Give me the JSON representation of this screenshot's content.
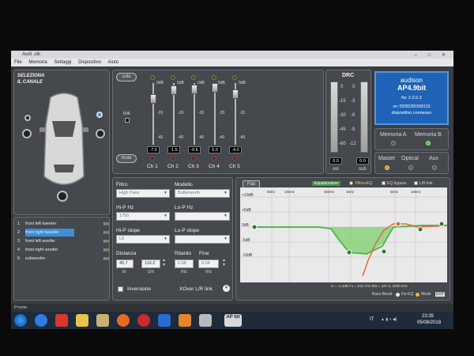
{
  "window": {
    "title": "Audi .stk"
  },
  "menu": {
    "items": [
      "File",
      "Memoria",
      "Settaggi",
      "Dispositivo",
      "Aiuto"
    ]
  },
  "channel_panel": {
    "title_line1": "SELEZIONA",
    "title_line2": "IL CANALE",
    "channels": [
      {
        "num": "1",
        "name": "front left tweeter",
        "selected": false
      },
      {
        "num": "2",
        "name": "front right tweeter",
        "selected": true
      },
      {
        "num": "3",
        "name": "front left woofer",
        "selected": false
      },
      {
        "num": "4",
        "name": "front right woofer",
        "selected": false
      },
      {
        "num": "5",
        "name": "subwoofer",
        "selected": false
      }
    ]
  },
  "mixer": {
    "solo_label": "solo",
    "mute_label": "mute",
    "link_label": "link",
    "scale": [
      "0dB",
      "-20",
      "-40"
    ],
    "channels": [
      {
        "label": "Ch 1",
        "value": "-7.0",
        "level": 0.18
      },
      {
        "label": "Ch 2",
        "value": "-1.5",
        "level": 0.04
      },
      {
        "label": "Ch 3",
        "value": "-0.5",
        "level": 0.02
      },
      {
        "label": "Ch 4",
        "value": "0.0",
        "level": 0.0
      },
      {
        "label": "Ch 5",
        "value": "-4.0",
        "level": 0.1
      }
    ]
  },
  "drc": {
    "title": "DRC",
    "left_scale": [
      "0",
      "-15",
      "-30",
      "-45",
      "-60"
    ],
    "right_scale": [
      "0",
      "-3",
      "-6",
      "-9",
      "-12"
    ],
    "vol_value": "0.0",
    "sub_value": "0.0",
    "vol_label": "vol",
    "sub_label": "sub"
  },
  "device": {
    "brand": "audison",
    "model": "AP4.9bit",
    "fw": "fw: 2.2.0.3",
    "serial": "sn: 00282281500133",
    "status": "dispositivo connesso"
  },
  "memory": {
    "a": "Memoria A",
    "b": "Memoria B"
  },
  "source": {
    "master": "Master",
    "optical": "Optical",
    "aux": "Aux"
  },
  "filter": {
    "filtro_label": "Filtro",
    "filtro_value": "High Pass",
    "modello_label": "Modello",
    "modello_value": "Butterworth",
    "hp_hz_label": "Hi-P Hz",
    "hp_hz_value": "1750",
    "lp_hz_label": "Lo-P Hz",
    "lp_hz_value": "",
    "hp_slope_label": "Hi-P slope",
    "hp_slope_value": "L8",
    "lp_slope_label": "Lo-P slope",
    "lp_slope_value": "",
    "distanza_label": "Distanza",
    "distanza_in": "45.7",
    "distanza_cm": "116.2",
    "in_label": "in",
    "cm_label": "cm",
    "ritardo_label": "Ritardo",
    "ritardo_value": "0.08",
    "ms_label": "ms",
    "fine_label": "Fine",
    "fine_value": "0.04",
    "inversione_label": "Inversione",
    "xover_label": "XOver L/R link"
  },
  "eq": {
    "flat_label": "Flat",
    "eq_tab": "Equalizzatore",
    "filter_eq": "Filtro+EQ",
    "eq_bypass": "EQ bypass",
    "lr_link": "L/R link",
    "y_labels": [
      "+10dB",
      "+5dB",
      "0dB",
      "-5dB",
      "-10dB"
    ],
    "x_labels": [
      "50Hz",
      "100Hz",
      "500Hz",
      "1kHz",
      "5kHz",
      "10kHz"
    ],
    "readout": "G = -4.2dB     F1 = 815.7Hz     BW = 327.0, 2990.0Hz",
    "bass_boost": "Bass-Boost",
    "de_eq": "De-EQ",
    "mode": "Mode",
    "exp": "EXP"
  },
  "status_text": "Pronto",
  "taskbar": {
    "app_label": "AP bit",
    "lang": "IT",
    "time": "23:35",
    "date": "05/08/2018"
  },
  "colors": {
    "accent_blue": "#1e63b7",
    "eq_green": "#55b84a",
    "eq_orange": "#e06a3a"
  }
}
